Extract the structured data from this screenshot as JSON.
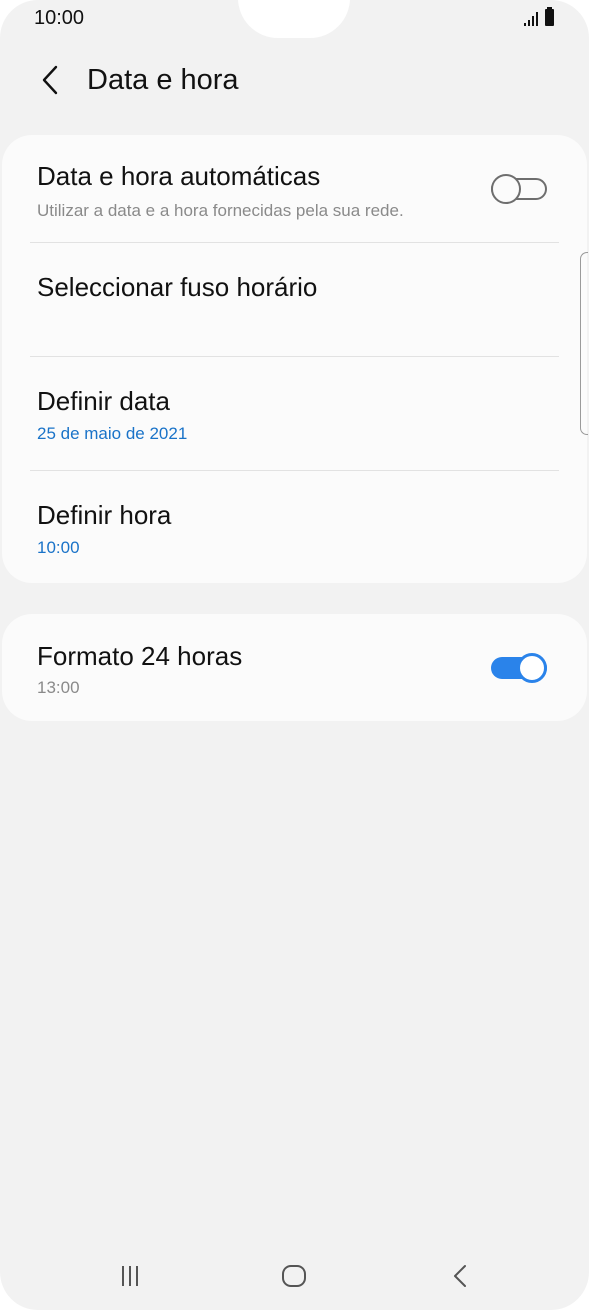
{
  "status_bar": {
    "time": "10:00"
  },
  "header": {
    "back_icon": "chevron-left-icon",
    "title": "Data e hora"
  },
  "settings": {
    "auto_datetime": {
      "title": "Data e hora automáticas",
      "subtitle": "Utilizar a data e a hora fornecidas pela sua rede.",
      "toggle_on": false
    },
    "timezone": {
      "title": "Seleccionar fuso horário"
    },
    "set_date": {
      "title": "Definir data",
      "value": "25 de maio de 2021"
    },
    "set_time": {
      "title": "Definir hora",
      "value": "10:00"
    },
    "format_24h": {
      "title": "Formato 24 horas",
      "subtitle": "13:00",
      "toggle_on": true
    }
  },
  "navigation_bar": {
    "recents_icon": "recent-apps-icon",
    "home_icon": "home-icon",
    "back_icon": "back-icon"
  },
  "colors": {
    "background": "#f2f2f2",
    "card": "#fbfbfb",
    "accent_blue": "#1a73c8",
    "toggle_on": "#2a83ea"
  }
}
